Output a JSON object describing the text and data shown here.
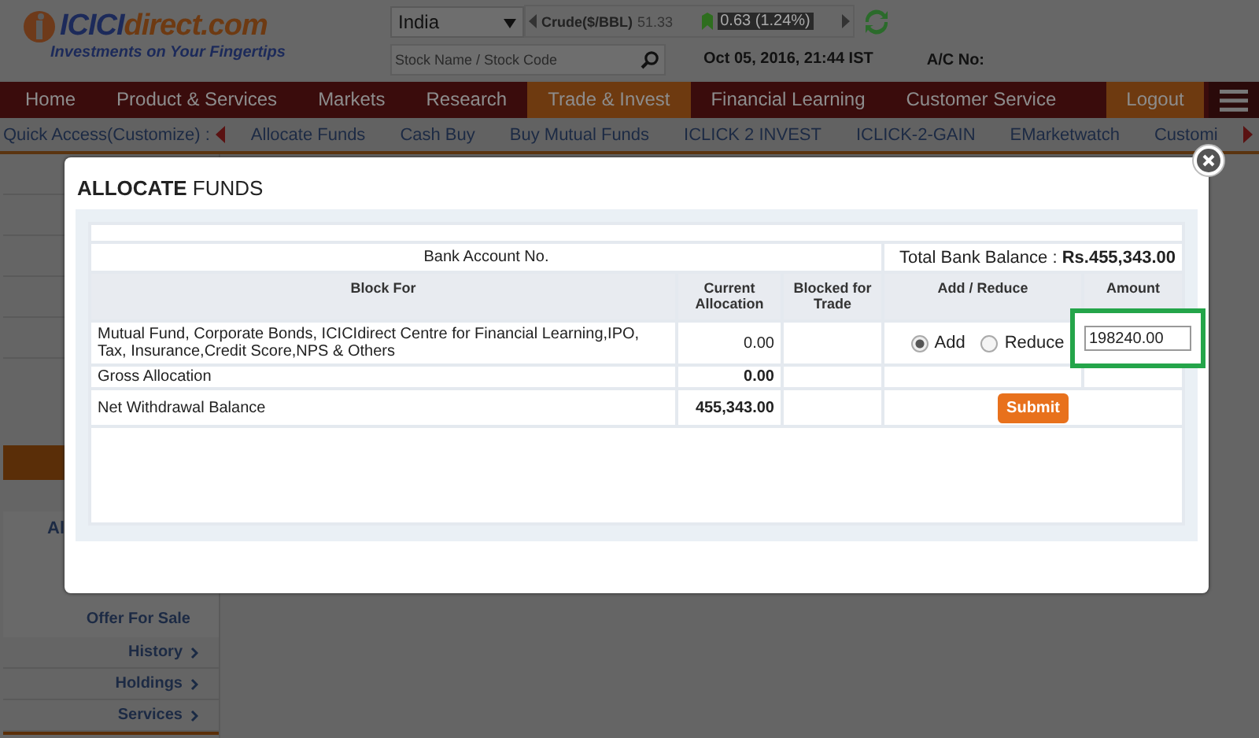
{
  "header": {
    "logo_brand": "ICICI",
    "logo_domain": "direct.com",
    "tagline": "Investments on Your Fingertips",
    "market_select": "India",
    "ticker_label": "Crude($/BBL)",
    "ticker_value": "51.33",
    "ticker_change": "0.63 (1.24%)",
    "search": {
      "placeholder": "Stock Name / Stock Code"
    },
    "datetime": "Oct 05, 2016, 21:44 IST",
    "account_label": "A/C No:"
  },
  "nav": {
    "items": [
      {
        "label": "Home",
        "selected": false
      },
      {
        "label": "Product & Services",
        "selected": false
      },
      {
        "label": "Markets",
        "selected": false
      },
      {
        "label": "Research",
        "selected": false
      },
      {
        "label": "Trade & Invest",
        "selected": true
      },
      {
        "label": "Financial Learning",
        "selected": false
      },
      {
        "label": "Customer Service",
        "selected": false
      }
    ],
    "logout": "Logout"
  },
  "quick_access": {
    "label": "Quick Access(Customize) :",
    "items": [
      "Allocate Funds",
      "Cash Buy",
      "Buy Mutual Funds",
      "ICLICK 2 INVEST",
      "ICLICK-2-GAIN",
      "EMarketwatch",
      "Customi"
    ]
  },
  "sidebar": {
    "panel_text": "Al",
    "panel_link": "Offer For Sale",
    "items": [
      "History",
      "Holdings",
      "Services"
    ]
  },
  "modal": {
    "title": "**ALLOCATE** FUNDS",
    "bank_account_label": "Bank Account No.",
    "total_balance_label": "Total Bank Balance :",
    "total_balance_value": "Rs.455,343.00",
    "columns": [
      "Block For",
      "Current Allocation",
      "Blocked for Trade",
      "Add / Reduce",
      "Amount"
    ],
    "block_row": {
      "block_for": "Mutual Fund, Corporate Bonds, ICICIdirect Centre for Financial Learning,IPO, Tax, Insurance,Credit Score,NPS & Others",
      "current_allocation": "0.00",
      "options": [
        {
          "label": "Add",
          "selected": true
        },
        {
          "label": "Reduce",
          "selected": false
        }
      ],
      "amount": "198240.00",
      "highlighted": true
    },
    "gross_row": {
      "label": "Gross Allocation",
      "value": "0.00"
    },
    "net_row": {
      "label": "Net Withdrawal Balance",
      "value": "455,343.00",
      "button": "Submit"
    }
  }
}
